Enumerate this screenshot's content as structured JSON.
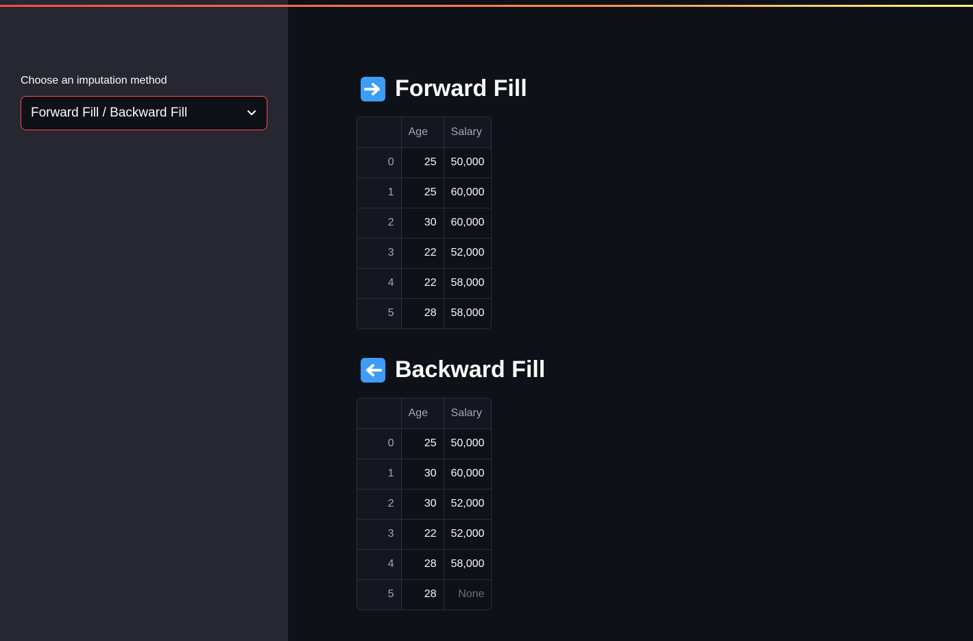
{
  "sidebar": {
    "select_label": "Choose an imputation method",
    "select_value": "Forward Fill / Backward Fill"
  },
  "forward": {
    "title": "Forward Fill",
    "icon": "right-arrow-emoji",
    "columns": [
      "Age",
      "Salary"
    ],
    "rows": [
      {
        "index": "0",
        "age": "25",
        "salary": "50,000"
      },
      {
        "index": "1",
        "age": "25",
        "salary": "60,000"
      },
      {
        "index": "2",
        "age": "30",
        "salary": "60,000"
      },
      {
        "index": "3",
        "age": "22",
        "salary": "52,000"
      },
      {
        "index": "4",
        "age": "22",
        "salary": "58,000"
      },
      {
        "index": "5",
        "age": "28",
        "salary": "58,000"
      }
    ]
  },
  "backward": {
    "title": "Backward Fill",
    "icon": "left-arrow-emoji",
    "columns": [
      "Age",
      "Salary"
    ],
    "rows": [
      {
        "index": "0",
        "age": "25",
        "salary": "50,000"
      },
      {
        "index": "1",
        "age": "30",
        "salary": "60,000"
      },
      {
        "index": "2",
        "age": "30",
        "salary": "52,000"
      },
      {
        "index": "3",
        "age": "22",
        "salary": "52,000"
      },
      {
        "index": "4",
        "age": "28",
        "salary": "58,000"
      },
      {
        "index": "5",
        "age": "28",
        "salary": "None"
      }
    ]
  },
  "colors": {
    "accent": "#ff4b4b",
    "sidebar_bg": "#262730",
    "main_bg": "#0e1117",
    "emoji_blue": "#3d9df6"
  }
}
